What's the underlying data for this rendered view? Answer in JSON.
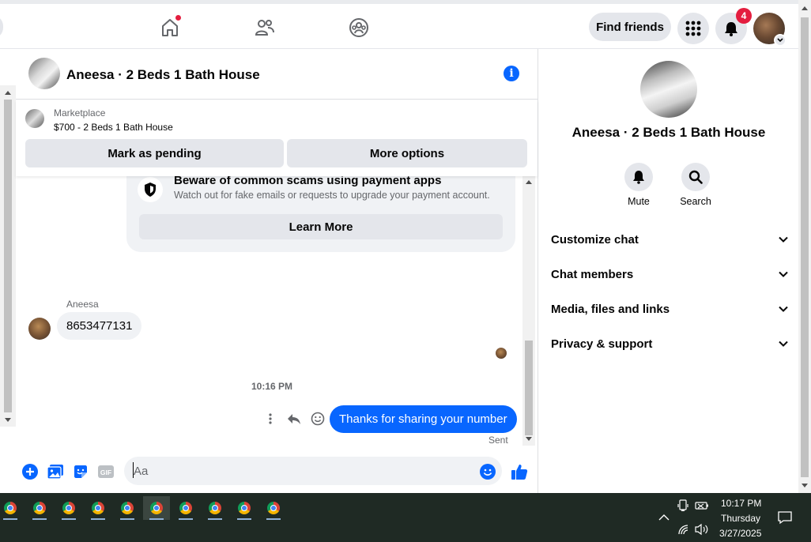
{
  "topnav": {
    "find_friends_label": "Find friends",
    "notifications_count": "4"
  },
  "chat": {
    "title": "Aneesa · 2 Beds 1 Bath House",
    "marketplace_label": "Marketplace",
    "listing": "$700 - 2 Beds 1 Bath House",
    "mark_pending_label": "Mark as pending",
    "more_options_label": "More options",
    "scam": {
      "title": "Beware of common scams using payment apps",
      "subtitle": "Watch out for fake emails or requests to upgrade your payment account.",
      "learn_more_label": "Learn More"
    },
    "sender_name": "Aneesa",
    "incoming_message": "8653477131",
    "timestamp": "10:16 PM",
    "outgoing_message": "Thanks for sharing your number",
    "sent_status": "Sent",
    "composer_placeholder": "Aa",
    "gif_label": "GIF"
  },
  "info_panel": {
    "title": "Aneesa · 2 Beds 1 Bath House",
    "actions": [
      {
        "label": "Mute",
        "icon": "bell-icon"
      },
      {
        "label": "Search",
        "icon": "search-icon"
      }
    ],
    "sections": [
      {
        "label": "Customize chat"
      },
      {
        "label": "Chat members"
      },
      {
        "label": "Media, files and links"
      },
      {
        "label": "Privacy & support"
      }
    ]
  },
  "taskbar": {
    "time": "10:17 PM",
    "day": "Thursday",
    "date": "3/27/2025",
    "apps": [
      "chrome",
      "chrome",
      "chrome",
      "chrome",
      "chrome",
      "chrome",
      "chrome",
      "chrome",
      "chrome",
      "chrome"
    ]
  },
  "colors": {
    "accent": "#0866ff",
    "badge": "#e41e3f",
    "taskbar": "#1f2a24"
  }
}
